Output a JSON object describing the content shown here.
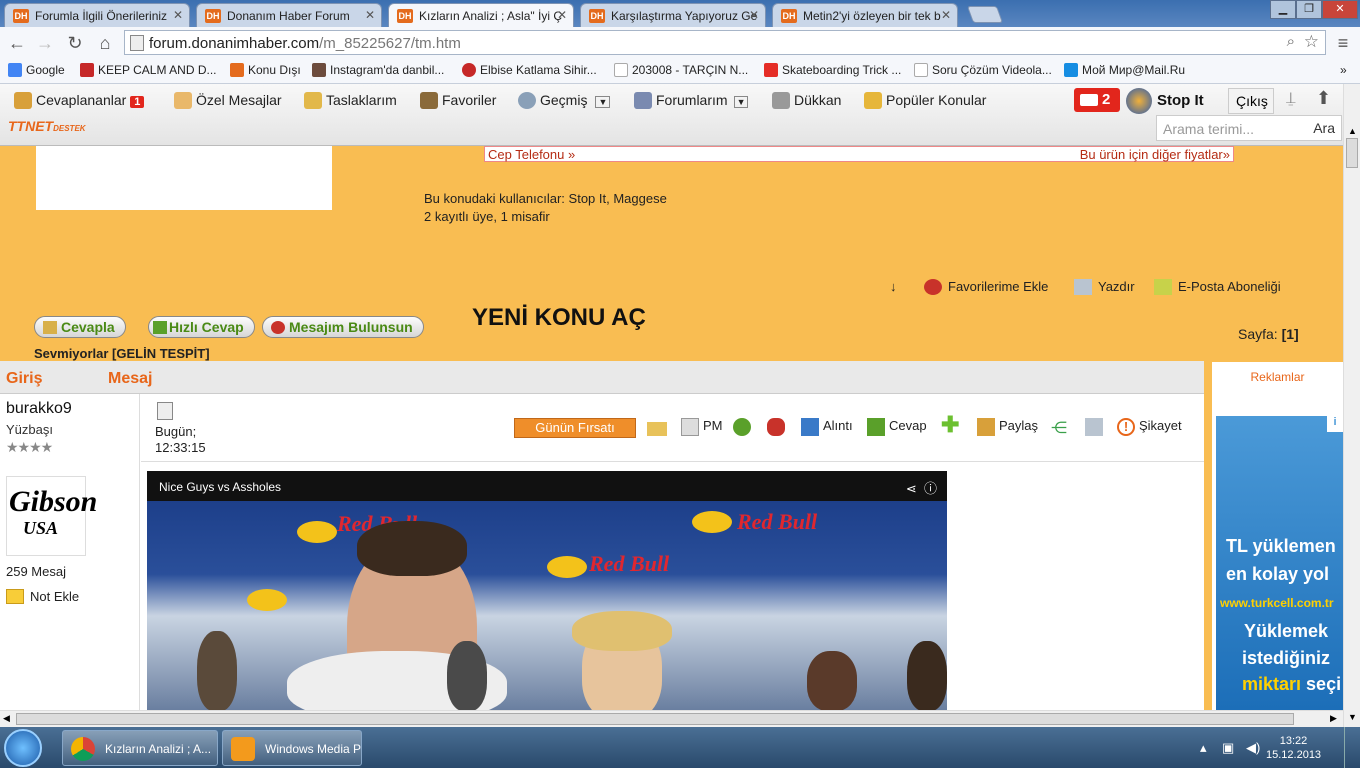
{
  "browser": {
    "tabs": [
      {
        "title": "Forumla İlgili Önerileriniz",
        "active": false
      },
      {
        "title": "Donanım Haber Forum",
        "active": false
      },
      {
        "title": "Kızların Analizi ; Asla\" İyi Ç",
        "active": true
      },
      {
        "title": "Karşılaştırma Yapıyoruz Ge",
        "active": false
      },
      {
        "title": "Metin2'yi özleyen bir tek b",
        "active": false
      }
    ],
    "address": {
      "host": "forum.donanimhaber.com",
      "path": "/m_85225627/tm.htm"
    },
    "bookmarks": [
      "Google",
      "KEEP CALM AND D...",
      "Konu Dışı",
      "Instagram'da danbil...",
      "Elbise Katlama Sihir...",
      "203008 - TARÇIN N...",
      "Skateboarding Trick ...",
      "Soru Çözüm Videola...",
      "Мой Мир@Mail.Ru"
    ]
  },
  "dhbar": {
    "cevaplananlar": "Cevaplananlar",
    "cevaplananlar_count": "1",
    "ozel_mesajlar": "Özel Mesajlar",
    "taslaklarim": "Taslaklarım",
    "favoriler": "Favoriler",
    "gecmis": "Geçmiş",
    "forumlarim": "Forumlarım",
    "dukkan": "Dükkan",
    "populer": "Popüler Konular",
    "notif_count": "2",
    "username": "Stop It",
    "cikis": "Çıkış",
    "search_placeholder": "Arama terimi...",
    "search_button": "Ara",
    "ttnet": "TTNET",
    "ttnet_sub": "DESTEK"
  },
  "page": {
    "price_left": "Cep Telefonu »",
    "price_right": "Bu ürün için diğer fiyatlar»",
    "users_label": "Bu konudaki kullanıcılar:",
    "users_names": "Stop It, Maggese",
    "users_count": "2 kayıtlı üye, 1 misafir",
    "action_fav": "Favorilerime Ekle",
    "action_print": "Yazdır",
    "action_email": "E-Posta Aboneliği",
    "btn_reply": "Cevapla",
    "btn_quick": "Hızlı Cevap",
    "btn_mine": "Mesajım Bulunsun",
    "new_topic": "YENİ KONU AÇ",
    "sayfa_label": "Sayfa:",
    "sayfa_value": "[1]",
    "thread_title": "Sevmiyorlar [GELİN TESPİT]",
    "col_giris": "Giriş",
    "col_mesaj": "Mesaj",
    "ads_label": "Reklamlar"
  },
  "post": {
    "username": "burakko9",
    "rank": "Yüzbaşı",
    "stars": "★★★★",
    "avatar_line1": "Gibson",
    "avatar_line2": "USA",
    "message_count": "259 Mesaj",
    "note": "Not Ekle",
    "date": "Bugün;",
    "time": "12:33:15",
    "gunun_firsati": "Günün Fırsatı",
    "pm": "PM",
    "alinti": "Alıntı",
    "cevap": "Cevap",
    "paylas": "Paylaş",
    "sikayet": "Şikayet",
    "video_title": "Nice Guys vs Assholes",
    "video_brand": "Red Bull"
  },
  "ad": {
    "line1": "TL yüklemen",
    "line2": "en kolay yol",
    "line3": "www.turkcell.com.tr",
    "line4": "Yüklemek",
    "line5": "istediğiniz",
    "line6a": "miktarı",
    "line6b": "seçi"
  },
  "taskbar": {
    "chrome_task": "Kızların Analizi ; A...",
    "wmp_task": "Windows Media P",
    "time": "13:22",
    "date": "15.12.2013"
  }
}
